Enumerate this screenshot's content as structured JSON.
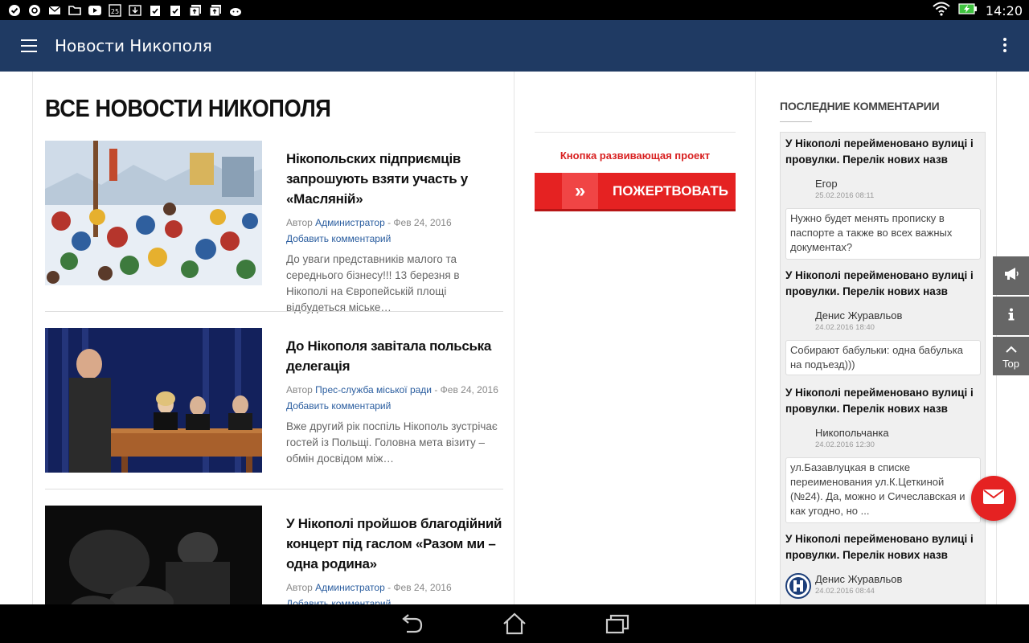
{
  "status_bar": {
    "time": "14:20",
    "notification_icons": [
      "check-circle-icon",
      "at-sign-icon",
      "mail-icon",
      "folder-icon",
      "youtube-icon",
      "calendar-icon",
      "download-icon",
      "clipboard-check-icon",
      "clipboard-check-icon",
      "photos-upload-icon",
      "photos-upload-icon",
      "android-debug-icon"
    ],
    "calendar_day": "25"
  },
  "app_bar": {
    "title": "Новости Никополя"
  },
  "main": {
    "heading": "ВСЕ НОВОСТИ НИКОПОЛЯ",
    "articles": [
      {
        "title": "Нікопольских підприємців запрошують взяти участь у «Масляній»",
        "meta_prefix": "Автор ",
        "author": "Администратор",
        "date": " - Фев 24, 2016",
        "add_comment": "Добавить комментарий",
        "excerpt": "До уваги представників малого та середнього бізнесу!!! 13 березня в Нікополі на Європейській площі відбудеться міське…"
      },
      {
        "title": "До Нікополя завітала польська делегація",
        "meta_prefix": "Автор ",
        "author": "Прес-служба міської ради",
        "date": " - Фев 24, 2016",
        "add_comment": "Добавить комментарий",
        "excerpt": "Вже другий рік поспіль Нікополь зустрічає гостей із Польщі. Головна мета візиту – обмін досвідом між…"
      },
      {
        "title": "У Нікополі пройшов благодійний концерт під гаслом «Разом ми – одна родина»",
        "meta_prefix": "Автор ",
        "author": "Администратор",
        "date": " - Фев 24, 2016",
        "add_comment": "Добавить комментарий",
        "excerpt": ""
      }
    ]
  },
  "middle": {
    "project_label": "Кнопка развивающая проект",
    "donate_label": "ПОЖЕРТВОВАТЬ",
    "donate_arrow": "»"
  },
  "sidebar": {
    "heading": "ПОСЛЕДНИЕ КОММЕНТАРИИ",
    "comments": [
      {
        "title": "У Нікополі перейменовано вулиці і провулки. Перелік нових назв",
        "author": "Егор",
        "date": "25.02.2016 08:11",
        "text": "Нужно будет менять прописку в паспорте а также во всех важных документах?"
      },
      {
        "title": "У Нікополі перейменовано вулиці і провулки. Перелік нових назв",
        "author": "Денис Журавльов",
        "date": "24.02.2016 18:40",
        "text": "Собирают бабульки: одна бабулька на подъезд)))"
      },
      {
        "title": "У Нікополі перейменовано вулиці і провулки. Перелік нових назв",
        "author": "Никопольчанка",
        "date": "24.02.2016 12:30",
        "text": "ул.Базавлуцкая в списке переименования ул.К.Цеткиной (№24). Да, можно и Сичеславская и как угодно, но ..."
      },
      {
        "title": "У Нікополі перейменовано вулиці і провулки. Перелік нових назв",
        "author": "Денис Журавльов",
        "date": "24.02.2016 08:44",
        "text": ""
      }
    ]
  },
  "floating": {
    "top_label": "Top"
  },
  "colors": {
    "app_bar": "#1f3a63",
    "accent_red": "#e52222",
    "link_blue": "#2a5d9f"
  }
}
